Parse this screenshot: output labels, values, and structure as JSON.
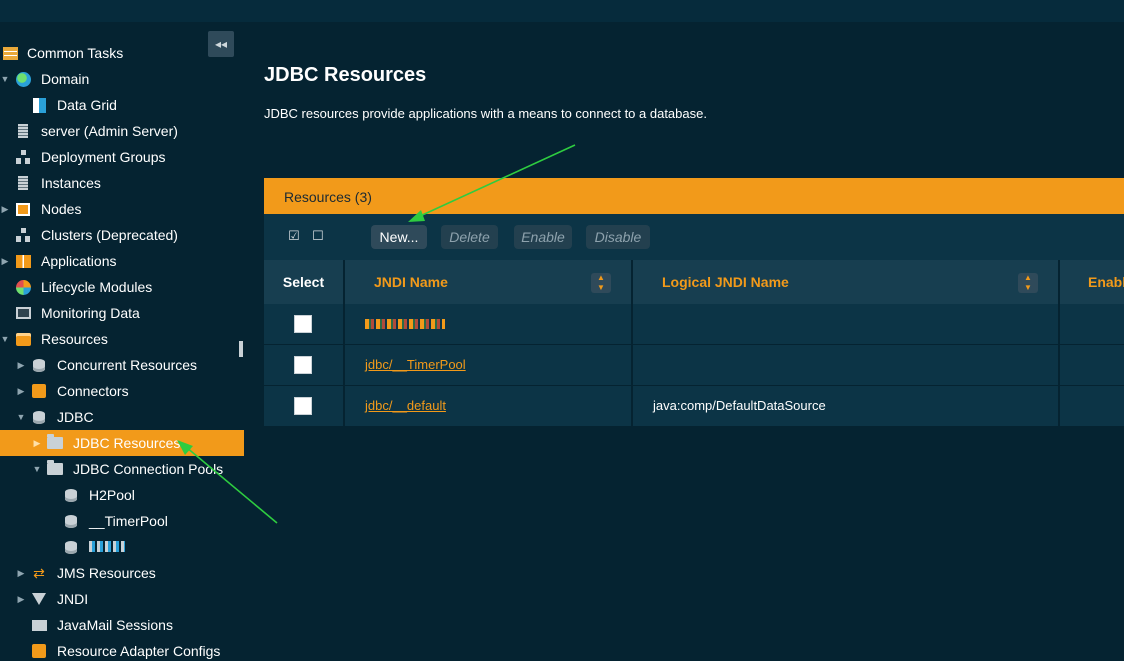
{
  "sidebar": {
    "collapse_label": "◂◂",
    "items": [
      {
        "label": "Common Tasks",
        "icon": "table-icon"
      },
      {
        "label": "Domain",
        "icon": "globe-icon"
      },
      {
        "label": "Data Grid",
        "icon": "data-grid-icon"
      },
      {
        "label": "server (Admin Server)",
        "icon": "server-icon"
      },
      {
        "label": "Deployment Groups",
        "icon": "tree-icon"
      },
      {
        "label": "Instances",
        "icon": "server-icon"
      },
      {
        "label": "Nodes",
        "icon": "node-icon"
      },
      {
        "label": "Clusters (Deprecated)",
        "icon": "tree-icon"
      },
      {
        "label": "Applications",
        "icon": "applications-icon"
      },
      {
        "label": "Lifecycle Modules",
        "icon": "lifecycle-icon"
      },
      {
        "label": "Monitoring Data",
        "icon": "monitor-icon"
      },
      {
        "label": "Resources",
        "icon": "resources-icon"
      },
      {
        "label": "Concurrent Resources",
        "icon": "database-icon"
      },
      {
        "label": "Connectors",
        "icon": "puzzle-icon"
      },
      {
        "label": "JDBC",
        "icon": "database-icon"
      },
      {
        "label": "JDBC Resources",
        "icon": "folder-icon"
      },
      {
        "label": "JDBC Connection Pools",
        "icon": "folder-icon"
      },
      {
        "label": "H2Pool",
        "icon": "database-icon"
      },
      {
        "label": "__TimerPool",
        "icon": "database-icon"
      },
      {
        "label": "",
        "icon": "database-icon"
      },
      {
        "label": "JMS Resources",
        "icon": "swap-icon"
      },
      {
        "label": "JNDI",
        "icon": "filter-icon"
      },
      {
        "label": "JavaMail Sessions",
        "icon": "mail-icon"
      },
      {
        "label": "Resource Adapter Configs",
        "icon": "puzzle-icon"
      }
    ]
  },
  "main": {
    "title": "JDBC Resources",
    "description": "JDBC resources provide applications with a means to connect to a database.",
    "table": {
      "caption": "Resources (3)",
      "toolbar": {
        "select_all_icon": "☑",
        "deselect_all_icon": "☐",
        "new_label": "New...",
        "delete_label": "Delete",
        "enable_label": "Enable",
        "disable_label": "Disable"
      },
      "columns": [
        "Select",
        "JNDI Name",
        "Logical JNDI Name",
        "Enabl"
      ],
      "rows": [
        {
          "jndi_name": "",
          "logical_jndi_name": ""
        },
        {
          "jndi_name": "jdbc/__TimerPool",
          "logical_jndi_name": ""
        },
        {
          "jndi_name": "jdbc/__default",
          "logical_jndi_name": "java:comp/DefaultDataSource"
        }
      ]
    }
  },
  "colors": {
    "accent": "#f29a1a",
    "background": "#052331",
    "panel": "#0c3446",
    "annotation_arrow": "#2ecc40"
  }
}
